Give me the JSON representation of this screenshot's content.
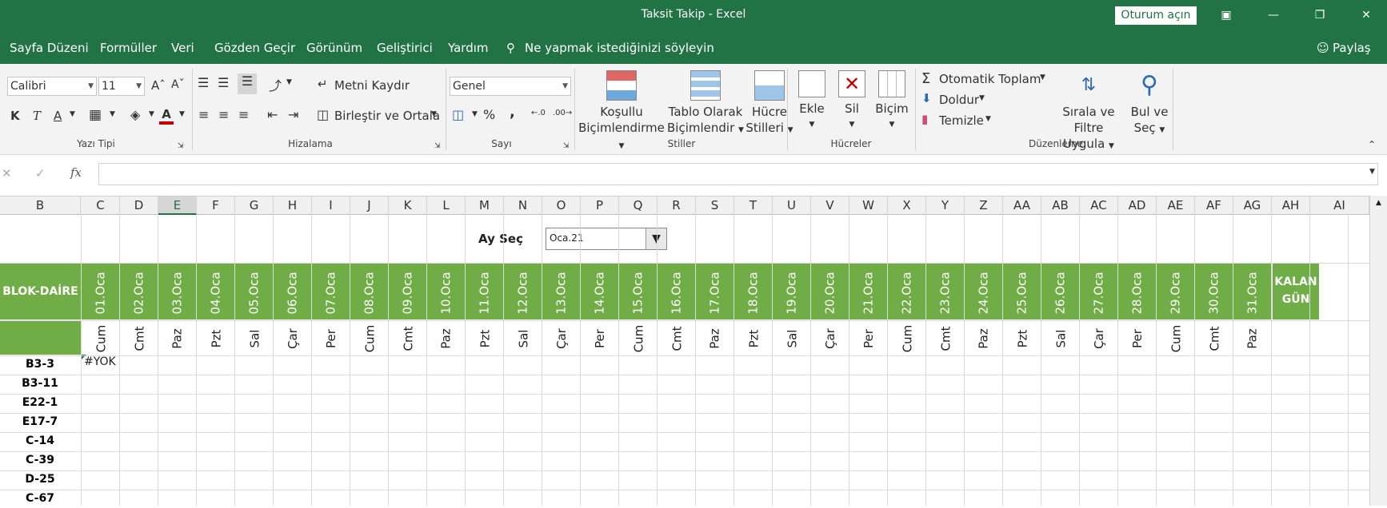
{
  "window": {
    "title": "Taksit Takip  -  Excel",
    "signin": "Oturum açın",
    "share": "Paylaş"
  },
  "menu": [
    "Sayfa Düzeni",
    "Formüller",
    "Veri",
    "Gözden Geçir",
    "Görünüm",
    "Geliştirici",
    "Yardım"
  ],
  "tellme": "Ne yapmak istediğinizi söyleyin",
  "ribbon": {
    "font_name": "Calibri",
    "font_size": "11",
    "wrap_text": "Metni Kaydır",
    "merge_center": "Birleştir ve Ortala",
    "number_format": "Genel",
    "cond_format": [
      "Koşullu",
      "Biçimlendirme"
    ],
    "table_format": [
      "Tablo Olarak",
      "Biçimlendir"
    ],
    "cell_styles": [
      "Hücre",
      "Stilleri"
    ],
    "insert": "Ekle",
    "delete": "Sil",
    "format": "Biçim",
    "autosum": "Otomatik Toplam",
    "fill": "Doldur",
    "clear": "Temizle",
    "sort_filter": [
      "Sırala ve Filtre",
      "Uygula"
    ],
    "find_select": [
      "Bul ve",
      "Seç"
    ],
    "groups": {
      "font": "Yazı Tipi",
      "align": "Hizalama",
      "number": "Sayı",
      "styles": "Stiller",
      "cells": "Hücreler",
      "editing": "Düzenleme"
    },
    "bold": "K",
    "italic": "T",
    "underline": "A",
    "percent": "%",
    "comma": ","
  },
  "formula_bar": {
    "fx": "fx",
    "value": ""
  },
  "columns": [
    "B",
    "C",
    "D",
    "E",
    "F",
    "G",
    "H",
    "I",
    "J",
    "K",
    "L",
    "M",
    "N",
    "O",
    "P",
    "Q",
    "R",
    "S",
    "T",
    "U",
    "V",
    "W",
    "X",
    "Y",
    "Z",
    "AA",
    "AB",
    "AC",
    "AD",
    "AE",
    "AF",
    "AG",
    "AH",
    "AI"
  ],
  "sheet": {
    "ay_sec_label": "Ay Seç",
    "ay_sec_value": "Oca.21",
    "header_left": "BLOK-DAİRE",
    "kalan_gun": [
      "KALAN",
      "GÜN"
    ],
    "dates": [
      "01.Oca",
      "02.Oca",
      "03.Oca",
      "04.Oca",
      "05.Oca",
      "06.Oca",
      "07.Oca",
      "08.Oca",
      "09.Oca",
      "10.Oca",
      "11.Oca",
      "12.Oca",
      "13.Oca",
      "14.Oca",
      "15.Oca",
      "16.Oca",
      "17.Oca",
      "18.Oca",
      "19.Oca",
      "20.Oca",
      "21.Oca",
      "22.Oca",
      "23.Oca",
      "24.Oca",
      "25.Oca",
      "26.Oca",
      "27.Oca",
      "28.Oca",
      "29.Oca",
      "30.Oca",
      "31.Oca"
    ],
    "days": [
      "Cum",
      "Cmt",
      "Paz",
      "Pzt",
      "Sal",
      "Çar",
      "Per",
      "Cum",
      "Cmt",
      "Paz",
      "Pzt",
      "Sal",
      "Çar",
      "Per",
      "Cum",
      "Cmt",
      "Paz",
      "Pzt",
      "Sal",
      "Çar",
      "Per",
      "Cum",
      "Cmt",
      "Paz",
      "Pzt",
      "Sal",
      "Çar",
      "Per",
      "Cum",
      "Cmt",
      "Paz"
    ],
    "rows": [
      "B3-3",
      "B3-11",
      "E22-1",
      "E17-7",
      "C-14",
      "C-39",
      "D-25",
      "C-67"
    ],
    "first_cell": "#YOK"
  }
}
